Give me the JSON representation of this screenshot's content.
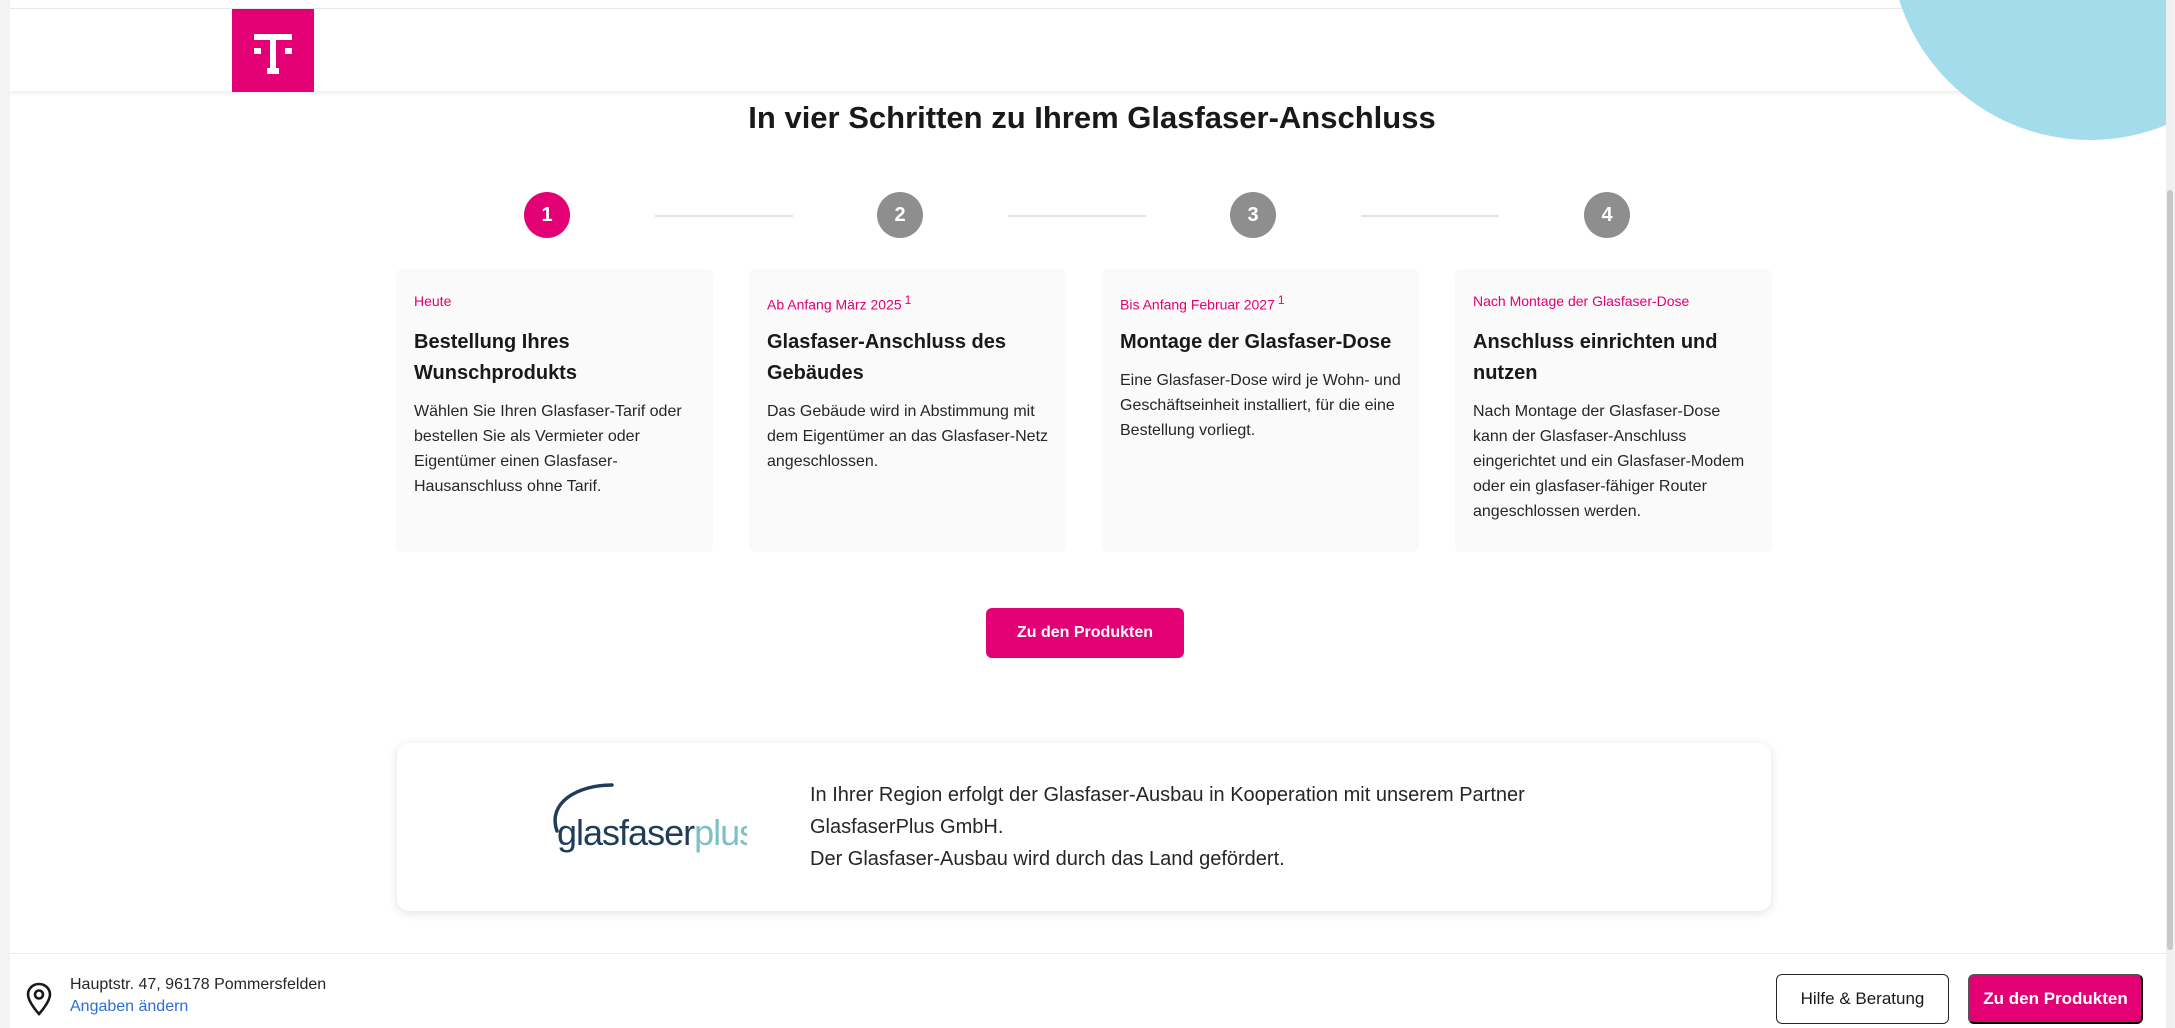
{
  "headline": "In vier Schritten zu Ihrem Glasfaser-Anschluss",
  "steps": [
    {
      "number": "1",
      "tag": "Heute",
      "footnote": "",
      "title": "Bestellung Ihres Wunschprodukts",
      "text": "Wählen Sie Ihren Glasfaser-Tarif oder bestellen Sie als Vermieter oder Eigentümer einen Glasfaser-Hausanschluss ohne Tarif."
    },
    {
      "number": "2",
      "tag": "Ab Anfang März 2025",
      "footnote": "1",
      "title": "Glasfaser-Anschluss des Gebäudes",
      "text": "Das Gebäude wird in Abstimmung mit dem Eigentümer an das Glasfaser-Netz angeschlossen."
    },
    {
      "number": "3",
      "tag": "Bis Anfang Februar 2027",
      "footnote": "1",
      "title": "Montage der Glasfaser-Dose",
      "text": "Eine Glasfaser-Dose wird je Wohn- und Geschäftseinheit installiert, für die eine Bestellung vorliegt."
    },
    {
      "number": "4",
      "tag": "Nach Montage der Glasfaser-Dose",
      "footnote": "",
      "title": "Anschluss einrichten und nutzen",
      "text": "Nach Montage der Glasfaser-Dose kann der Glasfaser-Anschluss eingerichtet und ein Glasfaser-Modem oder ein glasfaser-fähiger Router angeschlossen werden."
    }
  ],
  "cta_label": "Zu den Produkten",
  "partner": {
    "logo_text_main": "glasfaser",
    "logo_text_accent": "plus",
    "line1": "In Ihrer Region erfolgt der Glasfaser-Ausbau in Kooperation mit unserem Partner GlasfaserPlus GmbH.",
    "line2": "Der Glasfaser-Ausbau wird durch das Land gefördert."
  },
  "bottombar": {
    "address": "Hauptstr. 47, 96178 Pommersfelden",
    "change_link": "Angaben ändern",
    "help_label": "Hilfe & Beratung",
    "cta_label": "Zu den Produkten"
  },
  "colors": {
    "brand_magenta": "#e20074",
    "step_inactive": "#8e8e8e",
    "link_blue": "#2e6dd6",
    "deco_blue": "#a3dcea"
  },
  "icons": {
    "logo": "telekom-t-logo",
    "location": "location-pin-icon"
  }
}
